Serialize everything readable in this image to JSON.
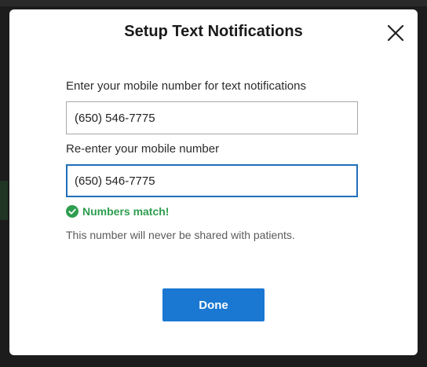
{
  "dialog": {
    "title": "Setup Text Notifications",
    "close_icon": "close-icon"
  },
  "form": {
    "mobile_label": "Enter your mobile number for text notifications",
    "mobile_value": "(650) 546-7775",
    "reenter_label": "Re-enter your mobile number",
    "reenter_value": "(650) 546-7775",
    "match_icon": "check-circle-icon",
    "match_text": "Numbers match!",
    "privacy_note": "This number will never be shared with patients."
  },
  "actions": {
    "done_label": "Done"
  },
  "colors": {
    "accent": "#1a78d2",
    "success": "#2e9e4f",
    "focus_border": "#1f6fb8"
  }
}
